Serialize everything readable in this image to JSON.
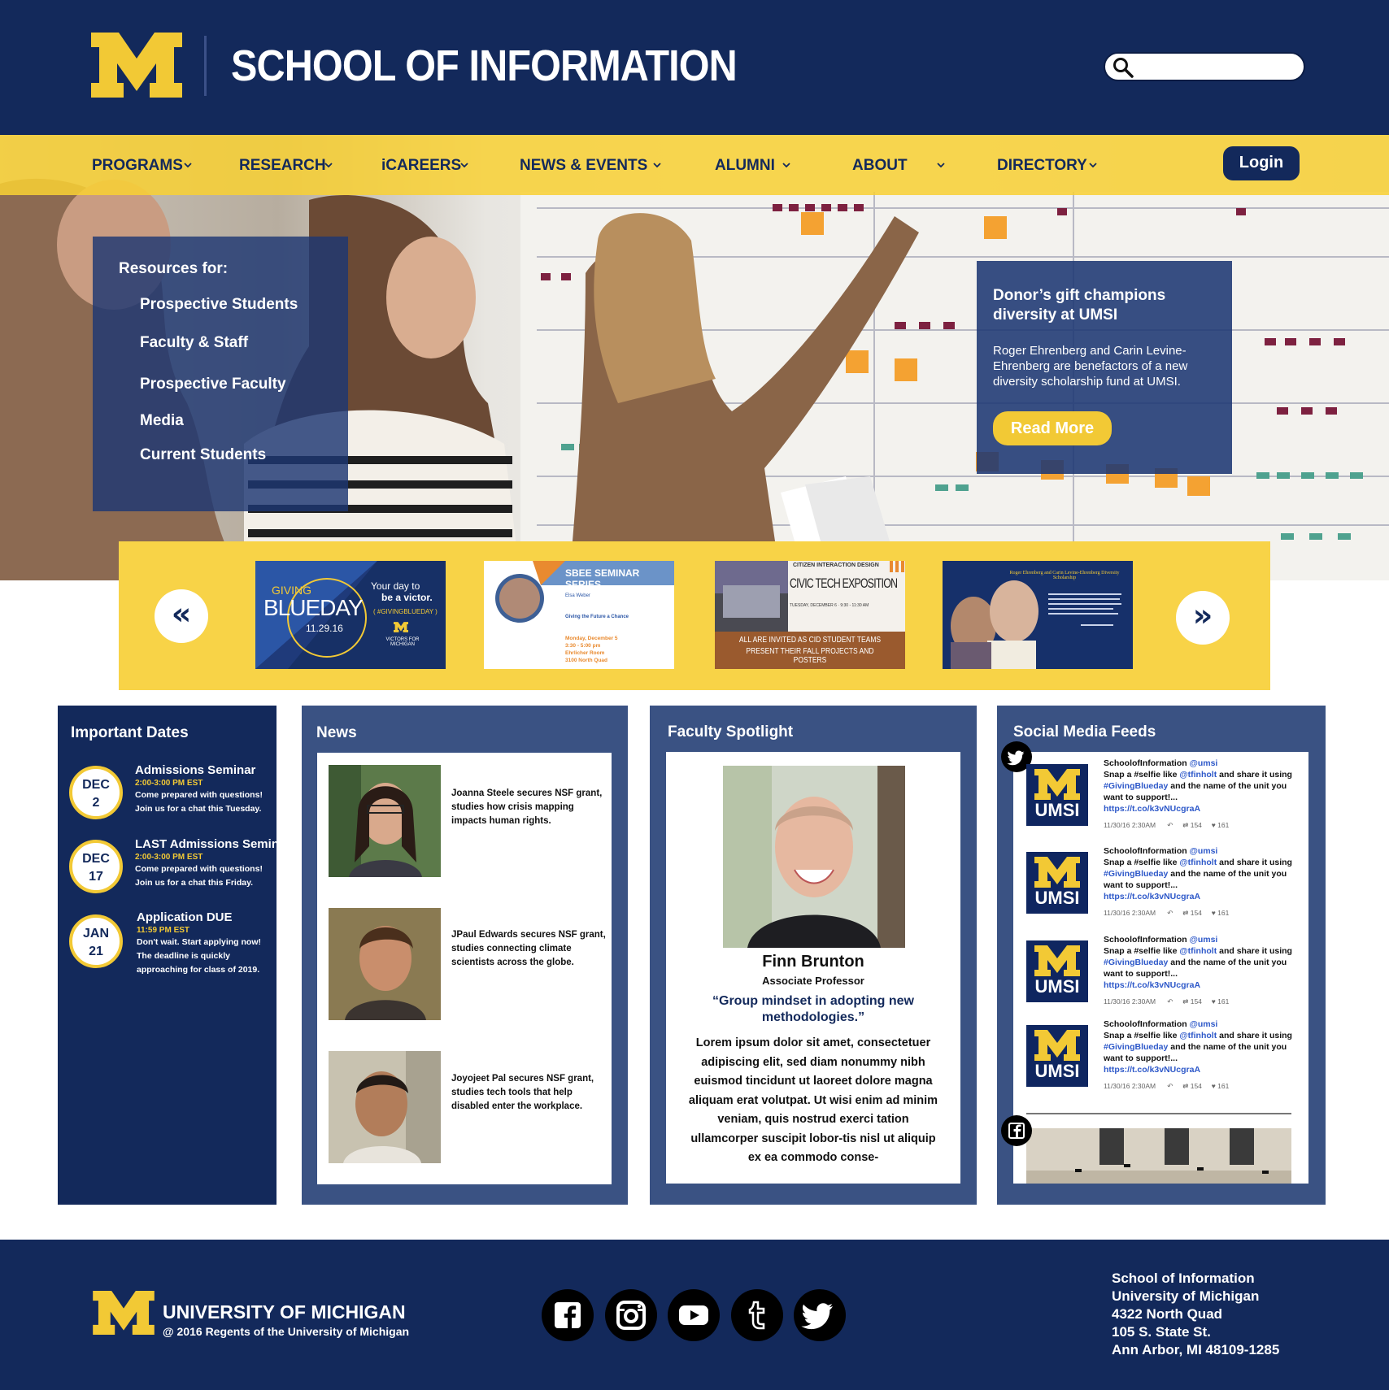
{
  "header": {
    "title": "SCHOOL OF INFORMATION",
    "search_placeholder": ""
  },
  "nav": {
    "items": [
      "PROGRAMS",
      "RESEARCH",
      "iCAREERS",
      "NEWS & EVENTS",
      "ALUMNI",
      "ABOUT",
      "DIRECTORY"
    ],
    "login_label": "Login"
  },
  "resources": {
    "title": "Resources for:",
    "items": [
      "Prospective Students",
      "Faculty & Staff",
      "Prospective Faculty",
      "Media",
      "Current Students"
    ]
  },
  "feature": {
    "title": "Donor’s gift champions diversity at UMSI",
    "description": "Roger Ehrenberg and Carin Levine-Ehrenberg are benefactors of a new diversity scholarship fund at UMSI.",
    "button_label": "Read More"
  },
  "carousel": {
    "prev_label": "«",
    "next_label": "»",
    "slides": [
      {
        "line1": "GIVING",
        "line2": "BLUEDAY",
        "date": "11.29.16",
        "tagline1": "Your day to",
        "tagline2": "be a victor.",
        "hashtag": "( #GIVINGBLUEDAY )",
        "footer": "VICTORS FOR MICHIGAN"
      },
      {
        "header": "SBEE SEMINAR SERIES",
        "name": "Elsa Weber",
        "subtitle": "Giving the Future a Chance",
        "when1": "Monday, December 5",
        "when2": "3:30 - 5:00 pm",
        "when3": "Ehrlicher Room",
        "when4": "3100 North Quad"
      },
      {
        "brand": "CITIZEN INTERACTION DESIGN",
        "title": "CIVIC TECH EXPOSITION",
        "details": "TUESDAY, DECEMBER 6 · 9:30 - 11:30 AM",
        "banner1": "ALL ARE INVITED AS CID STUDENT TEAMS",
        "banner2": "PRESENT THEIR FALL PROJECTS AND POSTERS"
      },
      {
        "title": "Roger Ehrenberg and Carin Levine-Ehrenberg Diversity Scholarship"
      }
    ]
  },
  "important_dates": {
    "title": "Important Dates",
    "events": [
      {
        "month": "DEC",
        "day": "2",
        "title": "Admissions Seminar",
        "time": "2:00-3:00 PM EST",
        "desc1": "Come prepared with questions!",
        "desc2": "Join us for a chat this Tuesday."
      },
      {
        "month": "DEC",
        "day": "17",
        "title": "LAST Admissions Seminar",
        "time": "2:00-3:00 PM EST",
        "desc1": "Come prepared with questions!",
        "desc2": "Join us for a chat this Friday."
      },
      {
        "month": "JAN",
        "day": "21",
        "title": "Application DUE",
        "time": "11:59 PM EST",
        "desc1": "Don't wait. Start applying now!",
        "desc2": "The deadline is quickly",
        "desc3": "approaching for class of 2019."
      }
    ]
  },
  "news": {
    "title": "News",
    "items": [
      "Joanna Steele secures NSF grant, studies how crisis mapping impacts human rights.",
      "JPaul Edwards secures NSF grant, studies connecting climate scientists across the globe.",
      "Joyojeet Pal secures NSF grant, studies tech tools that help disabled enter the workplace."
    ]
  },
  "faculty": {
    "title": "Faculty Spotlight",
    "name": "Finn Brunton",
    "role": "Associate Professor",
    "quote": "“Group mindset in adopting new methodologies.”",
    "body": "Lorem ipsum dolor sit amet, consectetuer adipiscing elit, sed diam nonummy nibh euismod tincidunt ut laoreet dolore magna aliquam erat volutpat. Ut wisi enim ad minim veniam, quis nostrud exerci tation ullamcorper suscipit lobor-tis nisl ut aliquip ex ea commodo conse-"
  },
  "social": {
    "title": "Social Media Feeds",
    "tweets": [
      {
        "user": "SchoolofInformation",
        "handle": "@umsi",
        "t1": "Snap a #selfie like",
        "mention": "@tfinholt",
        "t2": "and share it using",
        "tag": "#GivingBlueday",
        "t3": "and the name of the unit you want to support!...",
        "url": "https://t.co/k3vNUcgraA",
        "time": "11/30/16 2:30AM",
        "retweets": "154",
        "likes": "161"
      },
      {
        "user": "SchoolofInformation",
        "handle": "@umsi",
        "t1": "Snap a #selfie like",
        "mention": "@tfinholt",
        "t2": "and share it using",
        "tag": "#GivingBlueday",
        "t3": "and the name of the unit you want to support!...",
        "url": "https://t.co/k3vNUcgraA",
        "time": "11/30/16 2:30AM",
        "retweets": "154",
        "likes": "161"
      },
      {
        "user": "SchoolofInformation",
        "handle": "@umsi",
        "t1": "Snap a #selfie like",
        "mention": "@tfinholt",
        "t2": "and share it using",
        "tag": "#GivingBlueday",
        "t3": "and the name of the unit you want to support!...",
        "url": "https://t.co/k3vNUcgraA",
        "time": "11/30/16 2:30AM",
        "retweets": "154",
        "likes": "161"
      },
      {
        "user": "SchoolofInformation",
        "handle": "@umsi",
        "t1": "Snap a #selfie like",
        "mention": "@tfinholt",
        "t2": "and share it using",
        "tag": "#GivingBlueday",
        "t3": "and the name of the unit you want to support!...",
        "url": "https://t.co/k3vNUcgraA",
        "time": "11/30/16 2:30AM",
        "retweets": "154",
        "likes": "161"
      }
    ],
    "logo_text": "UMSI"
  },
  "footer": {
    "university": "UNIVERSITY OF MICHIGAN",
    "copyright": "@ 2016 Regents of the University of Michigan",
    "address": [
      "School of Information",
      "University of Michigan",
      "4322 North Quad",
      "105 S. State St.",
      "Ann Arbor, MI 48109-1285"
    ]
  },
  "colors": {
    "navy": "#13295b",
    "maize": "#f2c935",
    "panel_blue": "#3a5283"
  }
}
